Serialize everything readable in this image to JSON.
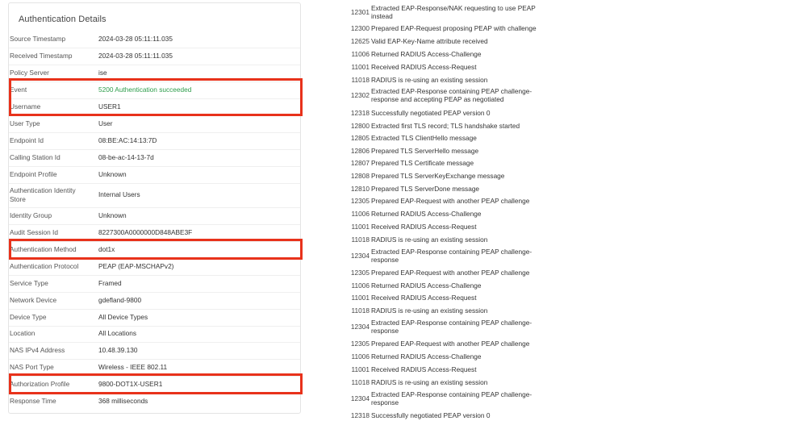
{
  "auth_details": {
    "title": "Authentication Details",
    "rows": [
      {
        "label": "Source Timestamp",
        "value": "2024-03-28 05:11:11.035"
      },
      {
        "label": "Received Timestamp",
        "value": "2024-03-28 05:11:11.035"
      },
      {
        "label": "Policy Server",
        "value": "ise"
      },
      {
        "label": "Event",
        "value": "5200 Authentication succeeded"
      },
      {
        "label": "Username",
        "value": "USER1"
      },
      {
        "label": "User Type",
        "value": "User"
      },
      {
        "label": "Endpoint Id",
        "value": "08:BE:AC:14:13:7D"
      },
      {
        "label": "Calling Station Id",
        "value": "08-be-ac-14-13-7d"
      },
      {
        "label": "Endpoint Profile",
        "value": "Unknown"
      },
      {
        "label": "Authentication Identity Store",
        "value": "Internal Users"
      },
      {
        "label": "Identity Group",
        "value": "Unknown"
      },
      {
        "label": "Audit Session Id",
        "value": "8227300A0000000D848ABE3F"
      },
      {
        "label": "Authentication Method",
        "value": "dot1x"
      },
      {
        "label": "Authentication Protocol",
        "value": "PEAP (EAP-MSCHAPv2)"
      },
      {
        "label": "Service Type",
        "value": "Framed"
      },
      {
        "label": "Network Device",
        "value": "gdefland-9800"
      },
      {
        "label": "Device Type",
        "value": "All Device Types"
      },
      {
        "label": "Location",
        "value": "All Locations"
      },
      {
        "label": "NAS IPv4 Address",
        "value": "10.48.39.130"
      },
      {
        "label": "NAS Port Type",
        "value": "Wireless - IEEE 802.11"
      },
      {
        "label": "Authorization Profile",
        "value": "9800-DOT1X-USER1"
      },
      {
        "label": "Response Time",
        "value": "368 milliseconds"
      }
    ]
  },
  "steps": [
    {
      "code": "12301",
      "text": "Extracted EAP-Response/NAK requesting to use PEAP instead"
    },
    {
      "code": "12300",
      "text": "Prepared EAP-Request proposing PEAP with challenge"
    },
    {
      "code": "12625",
      "text": "Valid EAP-Key-Name attribute received"
    },
    {
      "code": "11006",
      "text": "Returned RADIUS Access-Challenge"
    },
    {
      "code": "11001",
      "text": "Received RADIUS Access-Request"
    },
    {
      "code": "11018",
      "text": "RADIUS is re-using an existing session"
    },
    {
      "code": "12302",
      "text": "Extracted EAP-Response containing PEAP challenge-response and accepting PEAP as negotiated"
    },
    {
      "code": "12318",
      "text": "Successfully negotiated PEAP version 0"
    },
    {
      "code": "12800",
      "text": "Extracted first TLS record; TLS handshake started"
    },
    {
      "code": "12805",
      "text": "Extracted TLS ClientHello message"
    },
    {
      "code": "12806",
      "text": "Prepared TLS ServerHello message"
    },
    {
      "code": "12807",
      "text": "Prepared TLS Certificate message"
    },
    {
      "code": "12808",
      "text": "Prepared TLS ServerKeyExchange message"
    },
    {
      "code": "12810",
      "text": "Prepared TLS ServerDone message"
    },
    {
      "code": "12305",
      "text": "Prepared EAP-Request with another PEAP challenge"
    },
    {
      "code": "11006",
      "text": "Returned RADIUS Access-Challenge"
    },
    {
      "code": "11001",
      "text": "Received RADIUS Access-Request"
    },
    {
      "code": "11018",
      "text": "RADIUS is re-using an existing session"
    },
    {
      "code": "12304",
      "text": "Extracted EAP-Response containing PEAP challenge-response"
    },
    {
      "code": "12305",
      "text": "Prepared EAP-Request with another PEAP challenge"
    },
    {
      "code": "11006",
      "text": "Returned RADIUS Access-Challenge"
    },
    {
      "code": "11001",
      "text": "Received RADIUS Access-Request"
    },
    {
      "code": "11018",
      "text": "RADIUS is re-using an existing session"
    },
    {
      "code": "12304",
      "text": "Extracted EAP-Response containing PEAP challenge-response"
    },
    {
      "code": "12305",
      "text": "Prepared EAP-Request with another PEAP challenge"
    },
    {
      "code": "11006",
      "text": "Returned RADIUS Access-Challenge"
    },
    {
      "code": "11001",
      "text": "Received RADIUS Access-Request"
    },
    {
      "code": "11018",
      "text": "RADIUS is re-using an existing session"
    },
    {
      "code": "12304",
      "text": "Extracted EAP-Response containing PEAP challenge-response"
    },
    {
      "code": "12318",
      "text": "Successfully negotiated PEAP version 0"
    }
  ],
  "colors": {
    "success": "#2d9d4b",
    "highlight": "#e8321b",
    "border": "#e4e4e4"
  }
}
